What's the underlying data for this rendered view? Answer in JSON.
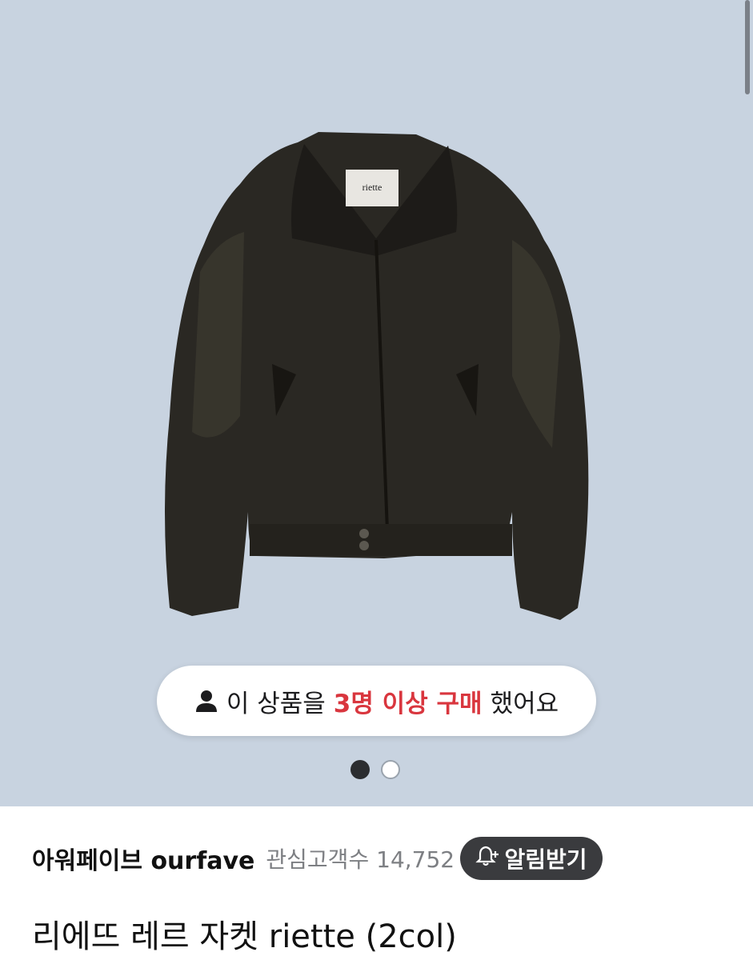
{
  "gallery": {
    "background_color": "#c8d3e0",
    "image_label": "riette",
    "badge": {
      "icon": "person-icon",
      "text_before": "이 상품을",
      "highlight": "3명 이상 구매",
      "text_after": "했어요",
      "highlight_color": "#d9363e"
    },
    "pagination": {
      "total": 2,
      "active_index": 0
    }
  },
  "seller": {
    "name": "아워페이브 ourfave",
    "fans_label": "관심고객수",
    "fans_count": "14,752",
    "notify_icon": "bell-plus-icon",
    "notify_label": "알림받기"
  },
  "product": {
    "title": "리에뜨 레르 자켓 riette (2col)"
  }
}
